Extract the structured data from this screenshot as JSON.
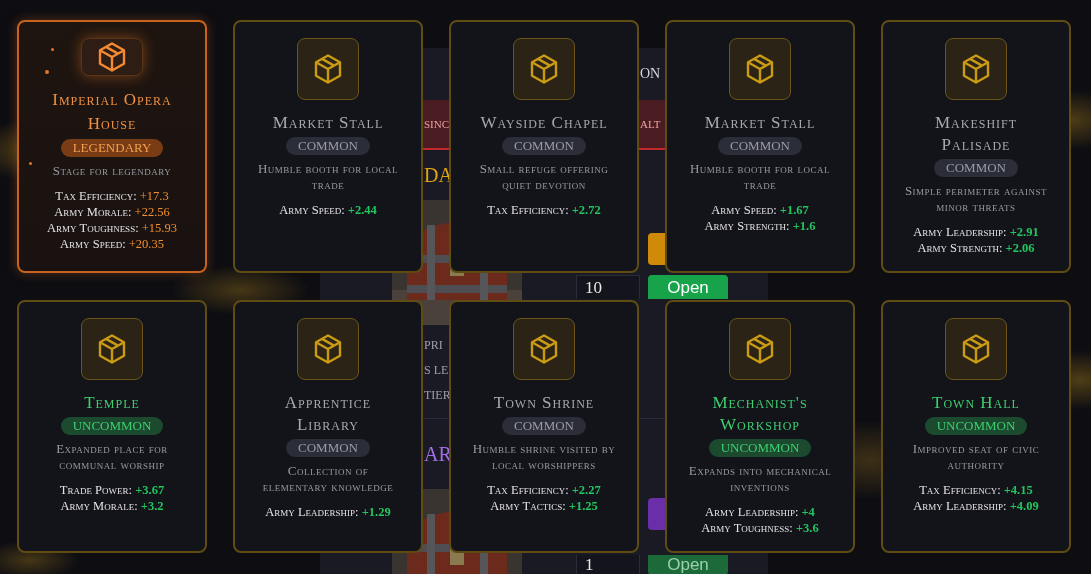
{
  "background_panel": {
    "header": "ON",
    "alert": [
      "SINC",
      "ALT"
    ],
    "sections": [
      {
        "title": "DA",
        "color": "#e0a510",
        "lines": [
          "PRI",
          "S LE",
          "TIER"
        ],
        "quantity": "10",
        "button": "Open",
        "action": {
          "color": "#d08a0a"
        }
      },
      {
        "title": "AR",
        "color": "#a36ee8",
        "quantity": "1",
        "button": "Open",
        "action": {
          "color": "#6a2fa8"
        }
      }
    ]
  },
  "cards": [
    {
      "kind": "legendary",
      "name": "Imperial Opera House",
      "rarity": "LEGENDARY",
      "description": "Stage for legendary",
      "stats": [
        {
          "label": "Tax Efficiency:",
          "value": "+17.3"
        },
        {
          "label": "Army Morale:",
          "value": "+22.56"
        },
        {
          "label": "Army Toughness:",
          "value": "+15.93"
        },
        {
          "label": "Army Speed:",
          "value": "+20.35"
        }
      ]
    },
    {
      "kind": "common",
      "name": "Market Stall",
      "rarity": "COMMON",
      "description": "Humble booth for local trade",
      "stats": [
        {
          "label": "Army Speed:",
          "value": "+2.44"
        }
      ]
    },
    {
      "kind": "common",
      "name": "Wayside Chapel",
      "rarity": "COMMON",
      "description": "Small refuge offering quiet devotion",
      "stats": [
        {
          "label": "Tax Efficiency:",
          "value": "+2.72"
        }
      ]
    },
    {
      "kind": "common",
      "name": "Market Stall",
      "rarity": "COMMON",
      "description": "Humble booth for local trade",
      "stats": [
        {
          "label": "Army Speed:",
          "value": "+1.67"
        },
        {
          "label": "Army Strength:",
          "value": "+1.6"
        }
      ]
    },
    {
      "kind": "common",
      "name": "Makeshift Palisade",
      "rarity": "COMMON",
      "description": "Simple perimeter against minor threats",
      "stats": [
        {
          "label": "Army Leadership:",
          "value": "+2.91"
        },
        {
          "label": "Army Strength:",
          "value": "+2.06"
        }
      ]
    },
    {
      "kind": "uncommon",
      "name": "Temple",
      "rarity": "UNCOMMON",
      "description": "Expanded place for communal worship",
      "stats": [
        {
          "label": "Trade Power:",
          "value": "+3.67"
        },
        {
          "label": "Army Morale:",
          "value": "+3.2"
        }
      ]
    },
    {
      "kind": "common",
      "name": "Apprentice Library",
      "rarity": "COMMON",
      "description": "Collection of elementary knowledge",
      "stats": [
        {
          "label": "Army Leadership:",
          "value": "+1.29"
        }
      ]
    },
    {
      "kind": "common",
      "name": "Town Shrine",
      "rarity": "COMMON",
      "description": "Humble shrine visited by local worshippers",
      "stats": [
        {
          "label": "Tax Efficiency:",
          "value": "+2.27"
        },
        {
          "label": "Army Tactics:",
          "value": "+1.25"
        }
      ]
    },
    {
      "kind": "uncommon",
      "name": "Mechanist's Workshop",
      "rarity": "UNCOMMON",
      "description": "Expands into mechanical inventions",
      "stats": [
        {
          "label": "Army Leadership:",
          "value": "+4"
        },
        {
          "label": "Army Toughness:",
          "value": "+3.6"
        }
      ]
    },
    {
      "kind": "uncommon",
      "name": "Town Hall",
      "rarity": "UNCOMMON",
      "description": "Improved seat of civic authority",
      "stats": [
        {
          "label": "Tax Efficiency:",
          "value": "+4.15"
        },
        {
          "label": "Army Leadership:",
          "value": "+4.09"
        }
      ]
    }
  ]
}
